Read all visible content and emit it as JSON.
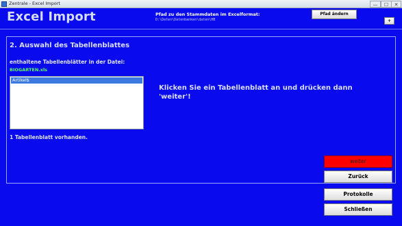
{
  "window": {
    "title": "Zentrale - Excel Import",
    "controls": {
      "minimize": "—",
      "maximize": "☐",
      "close": "✕"
    },
    "icon": "app-icon"
  },
  "header": {
    "app_title": "Excel Import",
    "path_label": "Pfad zu den Stammdaten im Excelformat:",
    "path_value": "D:\\Daten\\Datenbanken\\daten\\HB",
    "change_path_button": "Pfad ändern",
    "corner_button": "+"
  },
  "main": {
    "section_title": "2. Auswahl des Tabellenblattes",
    "sheets_label": "enthaltene Tabellenblätter in der Datei:",
    "file_name": "BIOGARTEN.xls",
    "sheets": [
      "Artikel$"
    ],
    "selected_sheet": "Artikel$",
    "sheet_count_text": "1 Tabellenblatt vorhanden.",
    "instruction": "Klicken Sie ein Tabellenblatt an und drücken dann 'weiter'!"
  },
  "buttons": {
    "weiter": "weiter",
    "zurueck": "Zurück",
    "protokolle": "Protokolle",
    "schliessen": "Schließen"
  },
  "colors": {
    "background": "#0a0aee",
    "weiter_button": "#ff0000",
    "file_name": "#56ff5a",
    "selection": "#3d77e0"
  }
}
